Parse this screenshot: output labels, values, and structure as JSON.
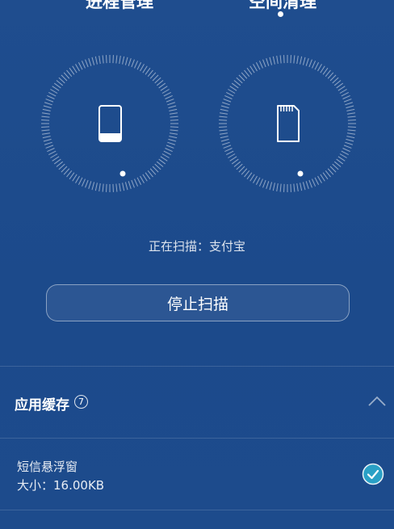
{
  "tabs": {
    "left_label": "进程管理",
    "right_label": "空间清理"
  },
  "dials": {
    "left_icon": "phone-icon",
    "right_icon": "sd-card-icon"
  },
  "scan": {
    "status_text": "正在扫描：支付宝",
    "stop_label": "停止扫描"
  },
  "section": {
    "title": "应用缓存",
    "count": "7",
    "collapse_icon": "chevron-up-icon"
  },
  "items": [
    {
      "name": "短信悬浮窗",
      "size_label": "大小：",
      "size_value": "16.00KB",
      "checked": true
    }
  ],
  "colors": {
    "background": "#1d4a8c",
    "check_fill": "#2aa0c6"
  }
}
